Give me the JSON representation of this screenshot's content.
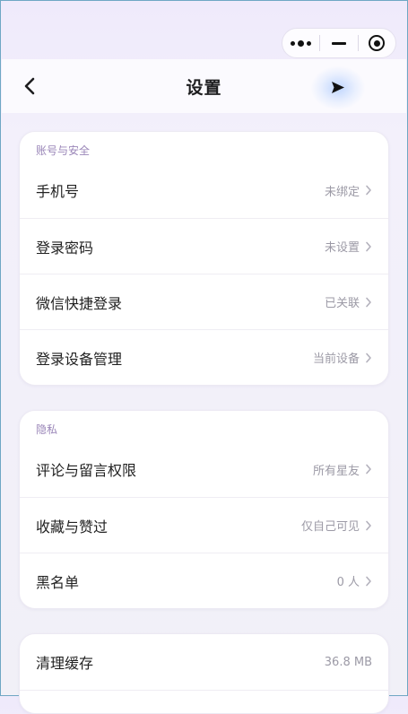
{
  "nav": {
    "title": "设置"
  },
  "sections": [
    {
      "title": "账号与安全",
      "rows": [
        {
          "label": "手机号",
          "value": "未绑定"
        },
        {
          "label": "登录密码",
          "value": "未设置"
        },
        {
          "label": "微信快捷登录",
          "value": "已关联"
        },
        {
          "label": "登录设备管理",
          "value": "当前设备"
        }
      ]
    },
    {
      "title": "隐私",
      "rows": [
        {
          "label": "评论与留言权限",
          "value": "所有星友"
        },
        {
          "label": "收藏与赞过",
          "value": "仅自己可见"
        },
        {
          "label": "黑名单",
          "value": "0 人"
        }
      ]
    },
    {
      "rows": [
        {
          "label": "清理缓存",
          "value": "36.8 MB"
        }
      ]
    }
  ]
}
